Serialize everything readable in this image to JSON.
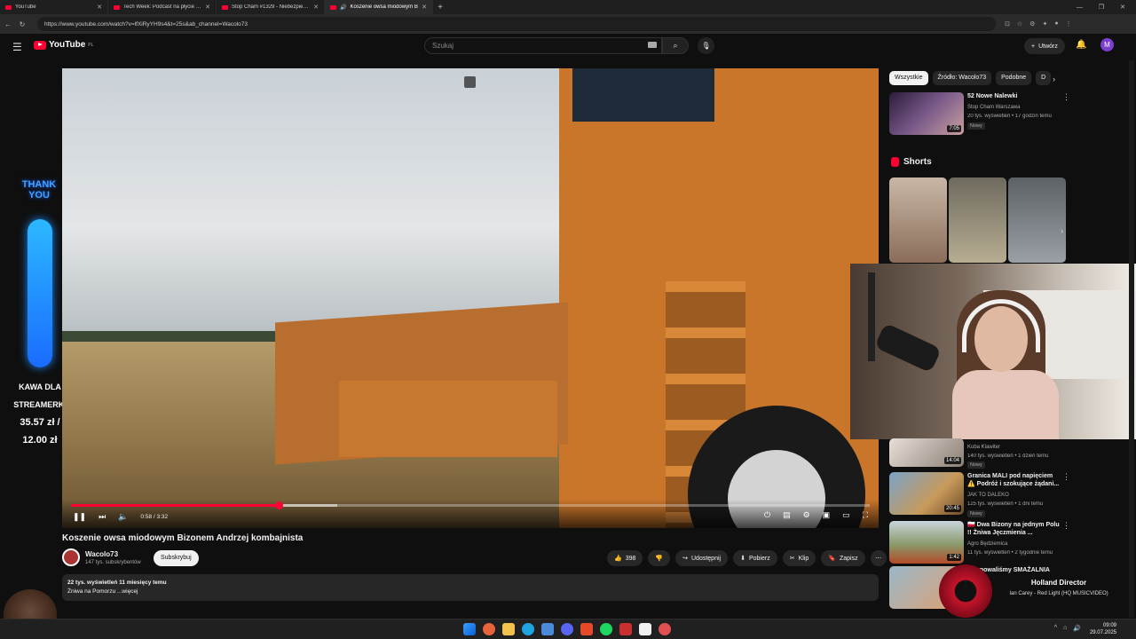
{
  "browser": {
    "tabs": [
      {
        "label": "YouTube",
        "active": false
      },
      {
        "label": "Tech Week: Podcast na płycie CD",
        "active": false
      },
      {
        "label": "Stop Cham #1329 - Niebezpieczn",
        "active": false
      },
      {
        "label": "Koszenie owsa miodowym B",
        "active": true
      }
    ],
    "url": "https://www.youtube.com/watch?v=lfXiRyYH9s4&t=25s&ab_channel=Wacolo73"
  },
  "header": {
    "logo_text": "YouTube",
    "logo_region": "PL",
    "search_placeholder": "Szukaj",
    "create_label": "Utwórz",
    "avatar_letter": "M"
  },
  "overlay_left": {
    "thank_line1": "THANK",
    "thank_line2": "YOU",
    "kawa_line1": "KAWA DLA",
    "kawa_line2": "STREAMERKI",
    "price_line1": "35.57 zł /",
    "price_line2": "12.00 zł"
  },
  "player": {
    "time_text": "0:58 / 3:32",
    "progress_fraction": 0.26
  },
  "video": {
    "title": "Koszenie owsa miodowym Bizonem Andrzej kombajnista",
    "channel": "Wacolo73",
    "subscribers": "147 tys. subskrybentów",
    "subscribe_label": "Subskrybuj",
    "likes": "398",
    "share_label": "Udostępnij",
    "download_label": "Pobierz",
    "clip_label": "Klip",
    "save_label": "Zapisz",
    "desc_meta": "22 tys. wyświetleń  11 miesięcy temu",
    "desc_text": "Żniwa na Pomorzu",
    "desc_more": "...więcej"
  },
  "sidebar": {
    "chips": [
      "Wszystkie",
      "Źródło: Wacolo73",
      "Podobne",
      "D"
    ],
    "shorts_label": "Shorts",
    "recs": [
      {
        "title": "52 Nowe Nalewki",
        "channel": "Stop Cham Warszawa",
        "meta": "20 tys. wyświetleń • 17 godzin temu",
        "badge": "Nowy",
        "duration": "7:05"
      },
      {
        "title": "",
        "channel": "Kuba Klawiter",
        "meta": "140 tys. wyświetleń • 1 dzień temu",
        "badge": "Nowy",
        "duration": "14:04"
      },
      {
        "title": "Granica MALI pod napięciem ⚠️ Podróż i szokujące żądani...",
        "channel": "JAK TO DALEKO",
        "meta": "125 tys. wyświetleń • 1 dni temu",
        "badge": "Nowy",
        "duration": "20:45"
      },
      {
        "title": "🇵🇱 Dwa Bizony na jednym Polu !! Żniwa Jęczmienia ...",
        "channel": "Agro Będziemica",
        "meta": "11 tys. wyświetleń • 2 tygodnie temu",
        "badge": "",
        "duration": "1:42"
      },
      {
        "title": "...kupowaliśmy SMAŻALNIA",
        "channel": "",
        "meta": "",
        "badge": "",
        "duration": ""
      }
    ]
  },
  "now_playing": {
    "title": "Holland Director",
    "artist": "Ian Carey - Red Light (HQ MUSICVIDEO)"
  },
  "taskbar": {
    "time": "09:09",
    "date": "29.07.2025"
  },
  "colors": {
    "accent_red": "#ff0033",
    "bg": "#0f0f0f",
    "pill_bg": "#272727"
  }
}
